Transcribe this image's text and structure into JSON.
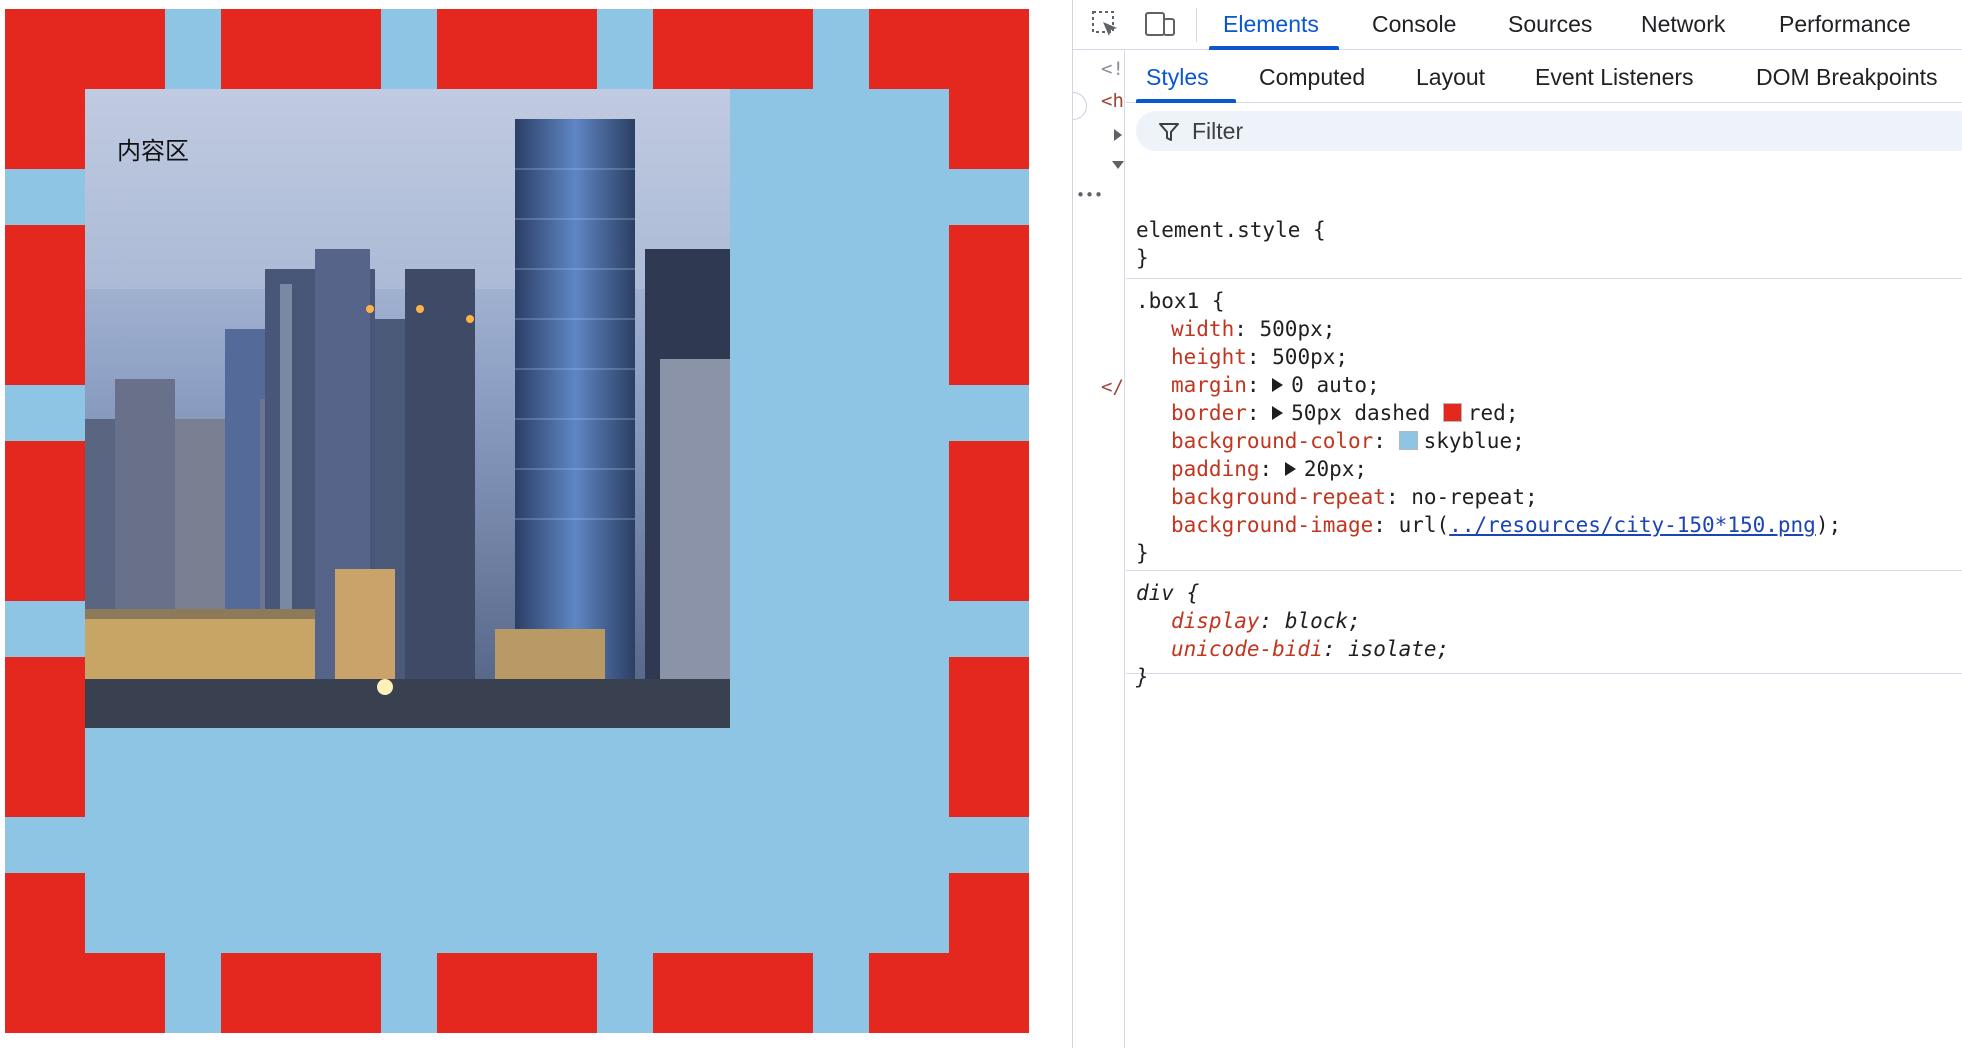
{
  "preview": {
    "content_label": "内容区",
    "colors": {
      "border": "#e5281f",
      "background": "#8ec5e5"
    }
  },
  "devtools": {
    "top_tabs": [
      "Elements",
      "Console",
      "Sources",
      "Network",
      "Performance"
    ],
    "active_top_tab": "Elements",
    "sub_tabs": [
      "Styles",
      "Computed",
      "Layout",
      "Event Listeners",
      "DOM Breakpoints"
    ],
    "active_sub_tab": "Styles",
    "filter_placeholder": "Filter",
    "gutter": {
      "a": "<!",
      "b": "<h",
      "c": "</",
      "dots": "•••"
    },
    "element_style": {
      "selector": "element.style {",
      "close": "}"
    },
    "box1_rule": {
      "selector": ".box1 {",
      "close": "}",
      "declarations": [
        {
          "prop": "width",
          "value": "500px;"
        },
        {
          "prop": "height",
          "value": "500px;"
        },
        {
          "prop": "margin",
          "value": "0 auto;"
        },
        {
          "prop": "border",
          "value": "50px dashed",
          "swatch_color": "#e5281f",
          "value_after": "red;"
        },
        {
          "prop": "background-color",
          "swatch_color": "#8ec5e5",
          "value": "skyblue;"
        },
        {
          "prop": "padding",
          "value": "20px;"
        },
        {
          "prop": "background-repeat",
          "value": "no-repeat;"
        },
        {
          "prop": "background-image",
          "value_prefix": "url(",
          "link": "../resources/city-150*150.png",
          "value_suffix": ");"
        }
      ]
    },
    "div_rule": {
      "selector": "div {",
      "close": "}",
      "declarations": [
        {
          "prop": "display",
          "value": "block;"
        },
        {
          "prop": "unicode-bidi",
          "value": "isolate;"
        }
      ]
    }
  }
}
